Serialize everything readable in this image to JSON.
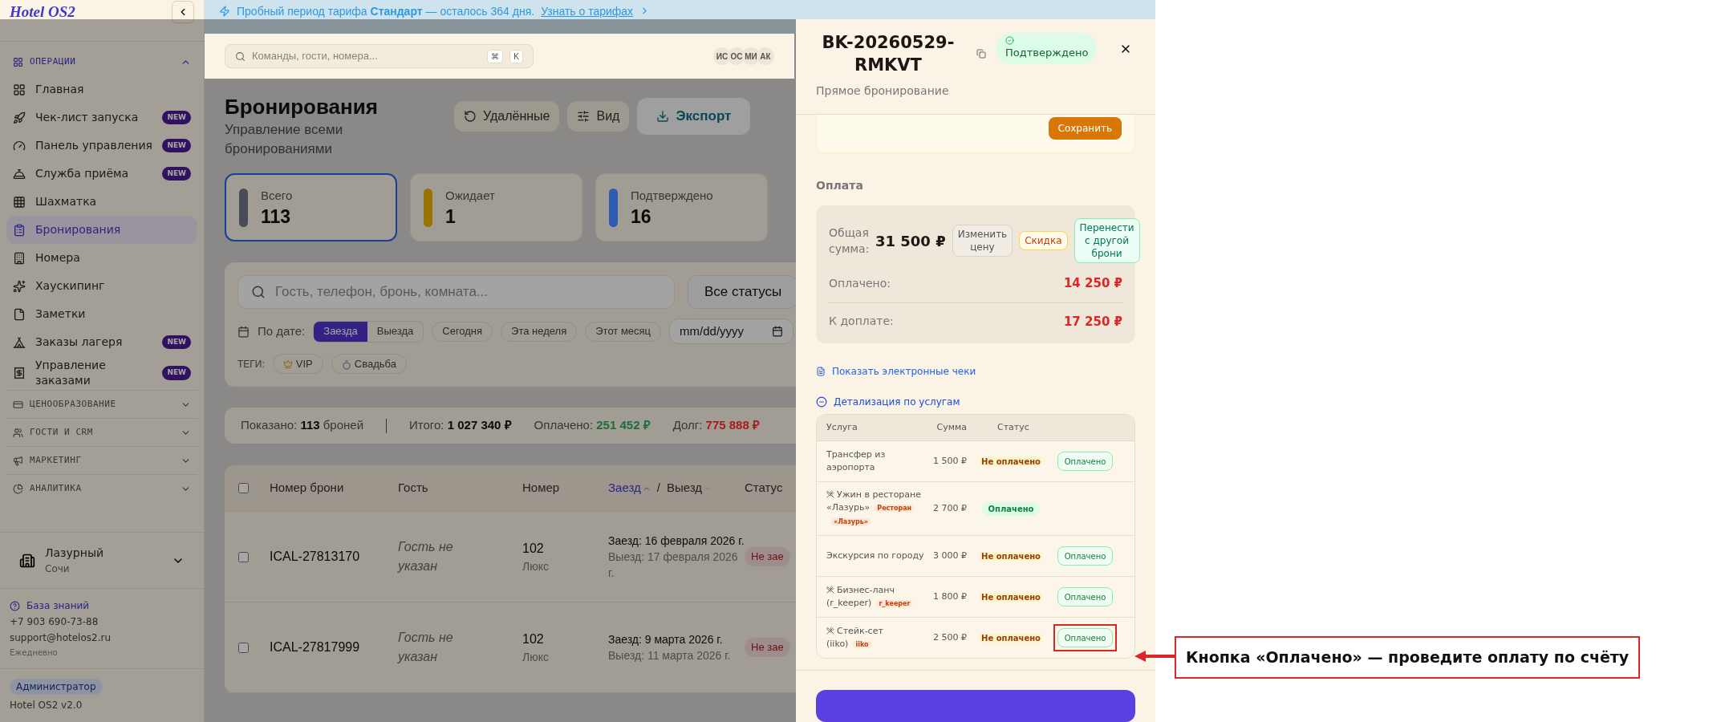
{
  "banner": {
    "text": "Пробный период тарифа **Стандарт** — осталось 364 дня.",
    "link": "Узнать о тарифах"
  },
  "sidebar": {
    "logo": "Hotel OS2",
    "sections": [
      {
        "label": "ОПЕРАЦИИ",
        "expanded": true,
        "items": [
          {
            "label": "Главная",
            "selected": false
          },
          {
            "label": "Чек-лист запуска",
            "badge": "NEW",
            "selected": false
          },
          {
            "label": "Панель управления",
            "badge": "NEW",
            "selected": false
          },
          {
            "label": "Служба приёма",
            "badge": "NEW",
            "selected": false
          },
          {
            "label": "Шахматка",
            "selected": false
          },
          {
            "label": "Бронирования",
            "selected": true
          },
          {
            "label": "Номера",
            "selected": false
          },
          {
            "label": "Хаускипинг",
            "selected": false
          },
          {
            "label": "Заметки",
            "selected": false
          },
          {
            "label": "Заказы лагеря",
            "badge": "NEW",
            "selected": false
          },
          {
            "label": "Управление заказами",
            "badge": "NEW",
            "selected": false
          }
        ]
      },
      {
        "label": "ЦЕНООБРАЗОВАНИЕ",
        "expanded": false
      },
      {
        "label": "ГОСТИ И CRM",
        "expanded": false
      },
      {
        "label": "МАРКЕТИНГ",
        "expanded": false
      },
      {
        "label": "АНАЛИТИКА",
        "expanded": false
      }
    ],
    "property": {
      "name": "Лазурный",
      "city": "Сочи"
    },
    "help": {
      "link": "База знаний",
      "phone": "+7 903 690-73-88",
      "email": "support@hotelos2.ru",
      "hours": "Ежедневно"
    },
    "role": "Администратор",
    "version": "Hotel OS2 v2.0"
  },
  "topbar": {
    "search_placeholder": "Команды, гости, номера...",
    "shortcut": [
      "⌘",
      "K"
    ],
    "avatars": [
      "ИС",
      "ОС",
      "МИ",
      "АК"
    ]
  },
  "page": {
    "title": "Бронирования",
    "subtitle": "Управление всеми бронированиями",
    "actions": [
      {
        "label": "Удалённые",
        "kind": "restore"
      },
      {
        "label": "Вид",
        "kind": "view"
      },
      {
        "label": "Экспорт",
        "kind": "export"
      }
    ],
    "stats": [
      {
        "label": "Всего",
        "value": "113",
        "color": "#464b55",
        "selected": true
      },
      {
        "label": "Ожидает",
        "value": "1",
        "color": "#9a7400",
        "selected": false
      },
      {
        "label": "Подтверждено",
        "value": "16",
        "color": "#2c5bb0",
        "selected": false
      }
    ],
    "filters": {
      "search_placeholder": "Гость, телефон, бронь, комната...",
      "status": "Все статусы",
      "date_label": "По дате:",
      "date_modes": [
        {
          "label": "Заезда",
          "selected": true
        },
        {
          "label": "Выезда",
          "selected": false
        }
      ],
      "presets": [
        "Сегодня",
        "Эта неделя",
        "Этот месяц"
      ],
      "date_placeholder": "mm/dd/yyyy",
      "tags_label": "ТЕГИ:",
      "tags": [
        {
          "label": "VIP",
          "kind": "crown"
        },
        {
          "label": "Свадьба",
          "kind": "ring"
        }
      ]
    },
    "summary": [
      {
        "label": "Показано:",
        "value": "113",
        "suffix": "броней"
      },
      {
        "label": "Итого:",
        "value": "1 027 340 ₽"
      },
      {
        "label": "Оплачено:",
        "value": "251 452 ₽",
        "color": "#1a6e3a"
      },
      {
        "label": "Долг:",
        "value": "775 888 ₽",
        "color": "#a61c1c"
      }
    ],
    "table": {
      "all_checked": false,
      "columns": [
        "Номер брони",
        "Гость",
        "Номер"
      ],
      "sort": [
        {
          "label": "Заезд",
          "selected": true
        },
        {
          "label": "Выезд",
          "selected": false
        }
      ],
      "sort_separator": "/",
      "status_column": "Статус",
      "rows": [
        {
          "checked": false,
          "id": "ICAL-27813170",
          "guest": "Гость не указан",
          "room": "102",
          "room_type": "Люкс",
          "checkin": "Заезд: 16 февраля 2026 г.",
          "checkout": "Выезд: 17 февраля 2026 г.",
          "status": "Не зае"
        },
        {
          "checked": false,
          "id": "ICAL-27817999",
          "guest": "Гость не указан",
          "room": "102",
          "room_type": "Люкс",
          "checkin": "Заезд: 9 марта 2026 г.",
          "checkout": "Выезд: 11 марта 2026 г.",
          "status": "Не зае"
        }
      ]
    }
  },
  "drawer": {
    "booking_id": "BK-20260529-RMKVT",
    "status": "Подтверждено",
    "source": "Прямое бронирование",
    "save": "Сохранить",
    "payment": {
      "title": "Оплата",
      "total_label": "Общая сумма:",
      "total": "31 500 ₽",
      "actions": [
        {
          "label": "Изменить цену",
          "kind": "neutral"
        },
        {
          "label": "Скидка",
          "kind": "discount"
        },
        {
          "label": "Перенести с другой брони",
          "kind": "transfer"
        }
      ],
      "paid_label": "Оплачено:",
      "paid": "14 250 ₽",
      "due_label": "К доплате:",
      "due": "17 250 ₽"
    },
    "receipts_link": "Показать электронные чеки",
    "breakdown": {
      "label": "Детализация по услугам",
      "expanded": true,
      "columns": [
        "Услуга",
        "Сумма",
        "Статус"
      ],
      "rows": [
        {
          "kind": "service",
          "name": "Трансфер из аэропорта",
          "amount": "1 500 ₽",
          "paid": false,
          "status": "Не оплачено",
          "action": "Оплачено",
          "highlighted": false
        },
        {
          "kind": "restaurant",
          "name": "Ужин в ресторане «Лазурь»",
          "tag": "Ресторан «Лазурь»",
          "amount": "2 700 ₽",
          "paid": true,
          "status": "Оплачено",
          "highlighted": false
        },
        {
          "kind": "service",
          "name": "Экскурсия по городу",
          "amount": "3 000 ₽",
          "paid": false,
          "status": "Не оплачено",
          "action": "Оплачено",
          "highlighted": false
        },
        {
          "kind": "restaurant",
          "name": "Бизнес-ланч (r_keeper)",
          "tag": "r_keeper",
          "amount": "1 800 ₽",
          "paid": false,
          "status": "Не оплачено",
          "action": "Оплачено",
          "highlighted": false
        },
        {
          "kind": "restaurant",
          "name": "Стейк-сет (iiko)",
          "tag": "iiko",
          "amount": "2 500 ₽",
          "paid": false,
          "status": "Не оплачено",
          "action": "Оплачено",
          "highlighted": true
        }
      ]
    }
  },
  "annotation": {
    "text": "Кнопка «Оплачено» — проведите оплату по счёту"
  }
}
